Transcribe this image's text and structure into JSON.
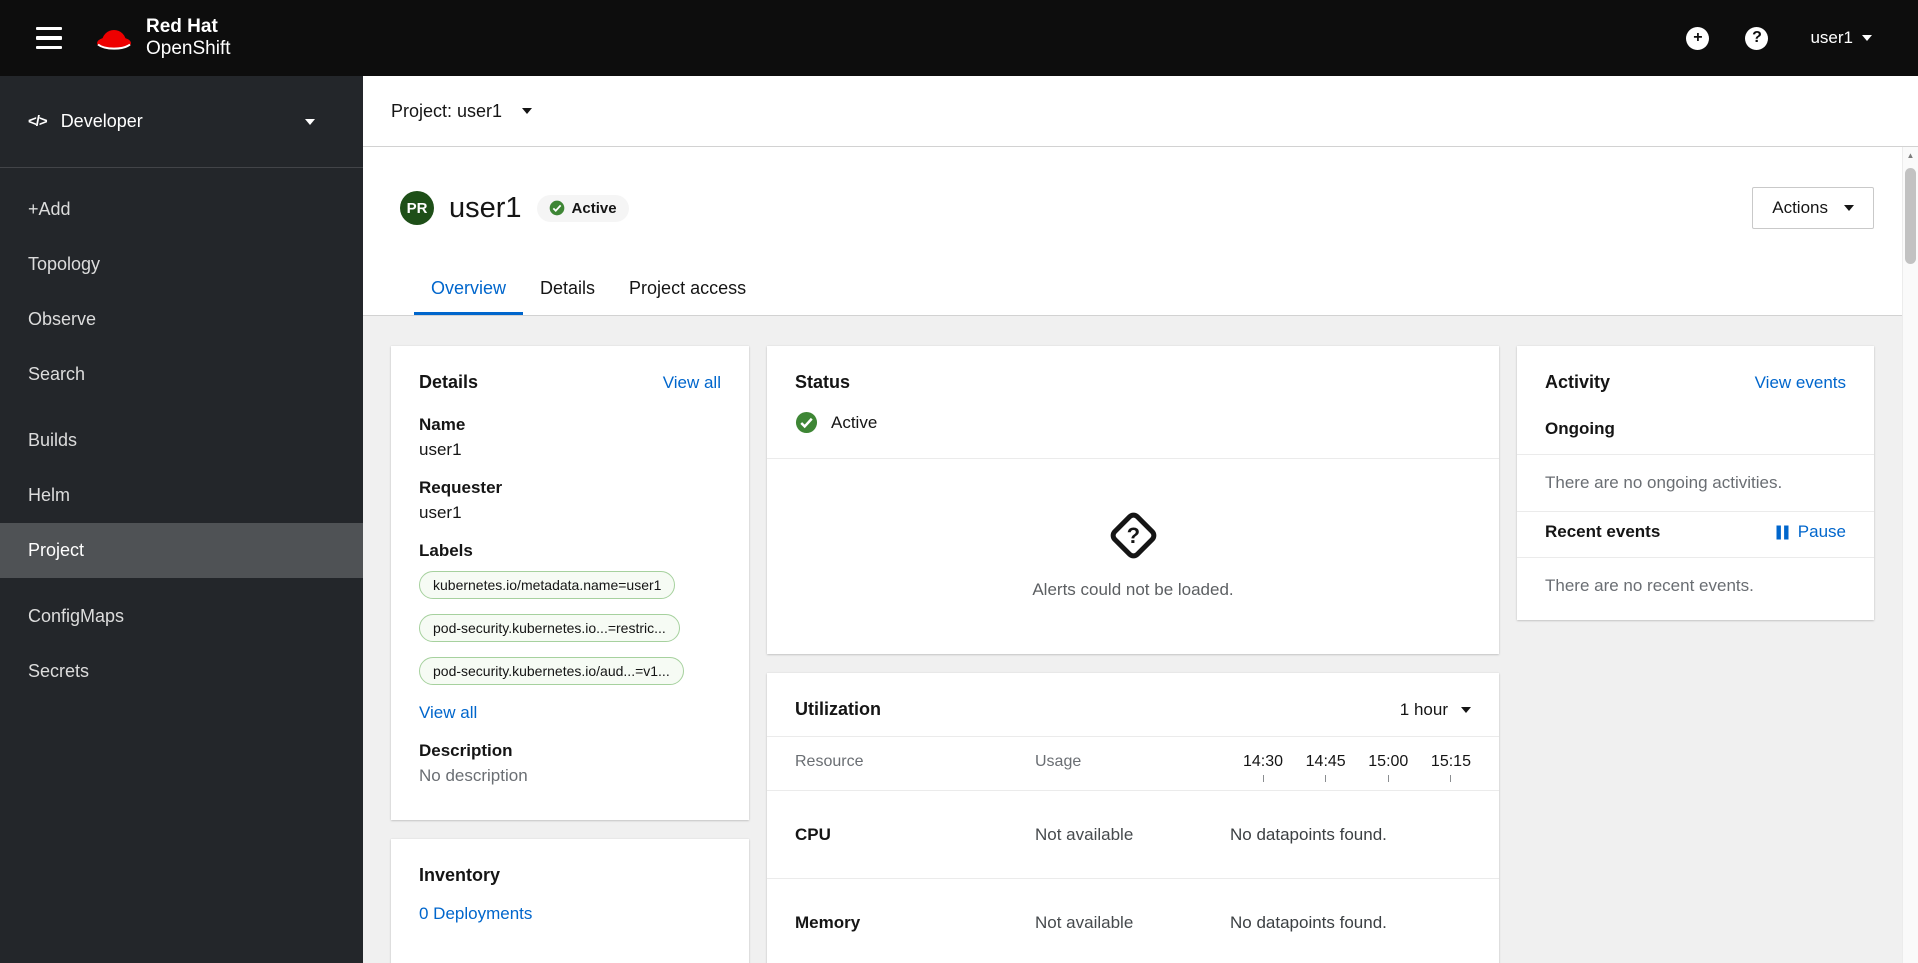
{
  "colors": {
    "accent_blue": "#0066cc",
    "brand_red": "#ee0000",
    "success_green": "#3e8635",
    "project_badge_green": "#1e4f18",
    "masthead_bg": "#0d0d0d",
    "sidebar_bg": "#23262a"
  },
  "icons": {
    "code": "</>",
    "plus": "+",
    "help": "?",
    "alerts_unknown": "?",
    "scroll_up": "▲"
  },
  "masthead": {
    "brand_line1": "Red Hat",
    "brand_line2": "OpenShift",
    "user": "user1"
  },
  "sidebar": {
    "perspective": "Developer",
    "items": [
      {
        "label": "+Add"
      },
      {
        "label": "Topology"
      },
      {
        "label": "Observe"
      },
      {
        "label": "Search"
      },
      {
        "label": "Builds"
      },
      {
        "label": "Helm"
      },
      {
        "label": "Project"
      },
      {
        "label": "ConfigMaps"
      },
      {
        "label": "Secrets"
      }
    ]
  },
  "project_bar": {
    "label": "Project: user1"
  },
  "page_header": {
    "badge": "PR",
    "title": "user1",
    "status": "Active",
    "actions": "Actions"
  },
  "tabs": [
    {
      "label": "Overview"
    },
    {
      "label": "Details"
    },
    {
      "label": "Project access"
    }
  ],
  "details_card": {
    "title": "Details",
    "view_all": "View all",
    "fields": [
      {
        "label": "Name",
        "value": "user1"
      },
      {
        "label": "Requester",
        "value": "user1"
      }
    ],
    "labels_label": "Labels",
    "labels": [
      "kubernetes.io/metadata.name=user1",
      "pod-security.kubernetes.io...=restric...",
      "pod-security.kubernetes.io/aud...=v1..."
    ],
    "labels_view_all": "View all",
    "description_label": "Description",
    "description_value": "No description"
  },
  "status_card": {
    "title": "Status",
    "status": "Active",
    "alerts_message": "Alerts could not be loaded."
  },
  "utilization_card": {
    "title": "Utilization",
    "duration": "1 hour",
    "col_resource": "Resource",
    "col_usage": "Usage",
    "times": [
      "14:30",
      "14:45",
      "15:00",
      "15:15"
    ],
    "rows": [
      {
        "resource": "CPU",
        "usage": "Not available",
        "datapoints": "No datapoints found."
      },
      {
        "resource": "Memory",
        "usage": "Not available",
        "datapoints": "No datapoints found."
      }
    ]
  },
  "activity_card": {
    "title": "Activity",
    "view_events": "View events",
    "ongoing_label": "Ongoing",
    "ongoing_empty": "There are no ongoing activities.",
    "recent_label": "Recent events",
    "pause_label": "Pause",
    "recent_empty": "There are no recent events."
  },
  "inventory_card": {
    "title": "Inventory",
    "deployments_link": "0 Deployments"
  }
}
